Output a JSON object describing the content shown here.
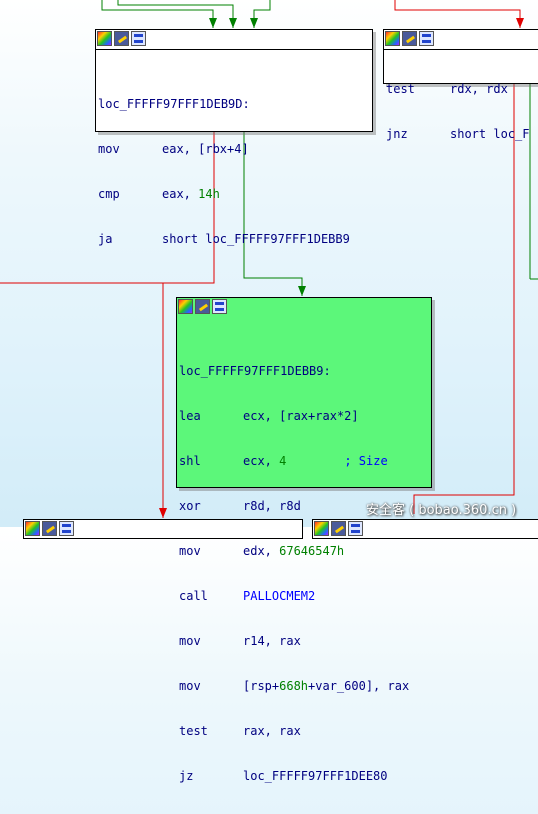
{
  "nodes": {
    "node1": {
      "label": "loc_FFFFF97FFF1DEB9D:",
      "lines": [
        {
          "mnem": "mov",
          "ops": "eax, [rbx+4]"
        },
        {
          "mnem": "cmp",
          "ops": "eax, ",
          "num": "14h"
        },
        {
          "mnem": "ja",
          "ops": "short loc_FFFFF97FFF1DEBB9"
        }
      ]
    },
    "node2": {
      "lines": [
        {
          "mnem": "test",
          "ops": "rdx, rdx"
        },
        {
          "mnem": "jnz",
          "ops": "short loc_F"
        }
      ]
    },
    "node3": {
      "label": "loc_FFFFF97FFF1DEBB9:",
      "lines": [
        {
          "mnem": "lea",
          "ops": "ecx, [rax+rax*2]"
        },
        {
          "mnem": "shl",
          "ops": "ecx, ",
          "num": "4",
          "comment": "; Size"
        },
        {
          "mnem": "xor",
          "ops": "r8d, r8d"
        },
        {
          "mnem": "mov",
          "ops": "edx, ",
          "num": "67646547h"
        },
        {
          "mnem": "call",
          "fn": "PALLOCMEM2"
        },
        {
          "mnem": "mov",
          "ops": "r14, rax"
        },
        {
          "mnem": "mov",
          "ops": "[rsp+",
          "num": "668h",
          "ops2": "+var_600], rax"
        },
        {
          "mnem": "test",
          "ops": "rax, rax"
        },
        {
          "mnem": "jz",
          "ops": "loc_FFFFF97FFF1DEE80"
        }
      ]
    }
  },
  "watermark": "安全客 ( bobao.360.cn )",
  "colors": {
    "true_edge": "#008000",
    "false_edge": "#e00000",
    "highlight_node": "#5cf77a"
  }
}
